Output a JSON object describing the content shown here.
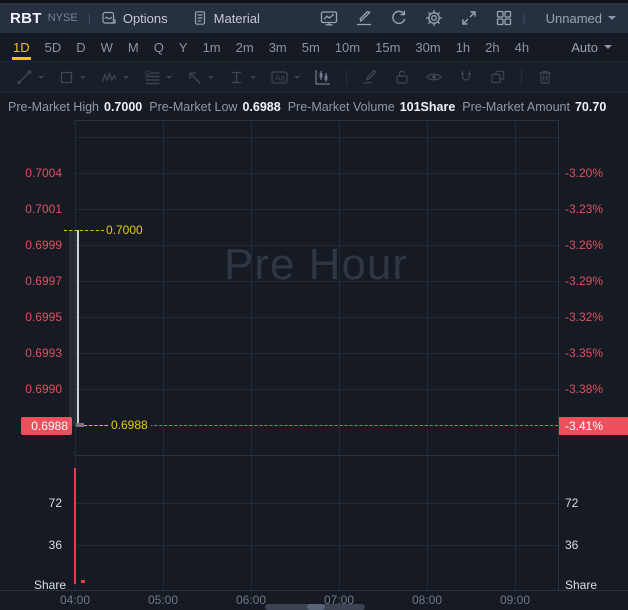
{
  "header": {
    "symbol": "RBT",
    "exchange": "NYSE",
    "menu": {
      "options": "Options",
      "material": "Material"
    },
    "workspace": "Unnamed"
  },
  "timeframe_bar": {
    "items": [
      "1D",
      "5D",
      "D",
      "W",
      "M",
      "Q",
      "Y",
      "1m",
      "2m",
      "3m",
      "5m",
      "10m",
      "15m",
      "30m",
      "1h",
      "2h",
      "4h"
    ],
    "active": "1D",
    "auto": "Auto"
  },
  "premarket": {
    "high_label": "Pre-Market High",
    "high": "0.7000",
    "low_label": "Pre-Market Low",
    "low": "0.6988",
    "volume_label": "Pre-Market Volume",
    "volume": "101Share",
    "amount_label": "Pre-Market Amount",
    "amount": "70.70"
  },
  "chart": {
    "watermark": "Pre Hour",
    "high_line_label": "0.7000",
    "low_line_label": "0.6988",
    "price_axis": [
      "0.7004",
      "0.7001",
      "0.6999",
      "0.6997",
      "0.6995",
      "0.6993",
      "0.6990"
    ],
    "price_axis_highlight": "0.6988",
    "pct_axis": [
      "-3.20%",
      "-3.23%",
      "-3.26%",
      "-3.29%",
      "-3.32%",
      "-3.35%",
      "-3.38%"
    ],
    "pct_axis_highlight": "-3.41%",
    "volume_axis": [
      "72",
      "36"
    ],
    "volume_unit": "Share",
    "x_ticks": [
      "04:00",
      "05:00",
      "06:00",
      "07:00",
      "08:00",
      "09:00"
    ]
  },
  "chart_data": {
    "type": "candlestick",
    "title": "RBT pre-market intraday",
    "session_watermark": "Pre Hour",
    "x_ticks": [
      "04:00",
      "05:00",
      "06:00",
      "07:00",
      "08:00",
      "09:00"
    ],
    "price_pane": {
      "y_axis_left_prices": [
        0.7004,
        0.7001,
        0.6999,
        0.6997,
        0.6995,
        0.6993,
        0.699,
        0.6988
      ],
      "y_axis_right_percent": [
        "-3.20%",
        "-3.23%",
        "-3.26%",
        "-3.29%",
        "-3.32%",
        "-3.35%",
        "-3.38%",
        "-3.41%"
      ],
      "series": [
        {
          "name": "RBT",
          "points": [
            {
              "time": "04:00",
              "high": 0.7,
              "low": 0.6988,
              "close": 0.6988
            }
          ]
        }
      ],
      "reference_lines": [
        {
          "value": 0.7,
          "label": "0.7000",
          "style": "dashed",
          "color": "#e3c408"
        },
        {
          "value": 0.6988,
          "label": "0.6988",
          "style": "dashed",
          "color": "#ee4f5c",
          "percent": "-3.41%"
        }
      ],
      "grid": true,
      "legend_position": "none"
    },
    "volume_pane": {
      "ylabel": "Share",
      "y_ticks": [
        72,
        36
      ],
      "bars": [
        {
          "time": "04:00",
          "value": 101
        }
      ],
      "bar_color": "#e0424e"
    }
  },
  "colors": {
    "accent_yellow": "#f2c50a",
    "axis_red": "#dd5260",
    "highlight_box_red": "#ee4f5c",
    "volume_bar_red": "#e0424e",
    "topbar_bg": "#273040",
    "chart_bg": "#161b23"
  }
}
